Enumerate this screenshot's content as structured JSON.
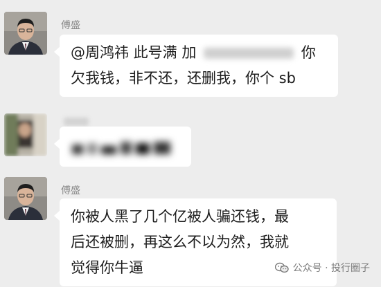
{
  "messages": [
    {
      "sender": "傅盛",
      "line1_prefix": "@周鸿祎 此号满 加",
      "line1_suffix": "你",
      "line2": "欠我钱，非不还，还删我，你个 sb"
    },
    {
      "sender": ""
    },
    {
      "sender": "傅盛",
      "line1": "你被人黑了几个亿被人骗还钱，最",
      "line2": "后还被删，再这么不以为然，我就",
      "line3": "觉得你牛逼"
    }
  ],
  "watermark": {
    "text": "公众号 · 投行圈子",
    "icon": "wechat-official-account-icon"
  },
  "colors": {
    "background": "#ededed",
    "bubble": "#ffffff",
    "text": "#1c1c1c",
    "sender": "#8a8a8a"
  }
}
